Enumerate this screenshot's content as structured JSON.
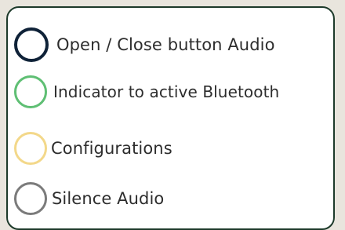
{
  "legend": {
    "items": [
      {
        "icon": "circle-icon",
        "color": "#0f2238",
        "label": "Open / Close button Audio"
      },
      {
        "icon": "circle-icon",
        "color": "#5fbf74",
        "label": "Indicator to active Bluetooth"
      },
      {
        "icon": "circle-icon",
        "color": "#f3d88a",
        "label": "Configurations"
      },
      {
        "icon": "circle-icon",
        "color": "#7b7b7b",
        "label": "Silence Audio"
      }
    ]
  }
}
